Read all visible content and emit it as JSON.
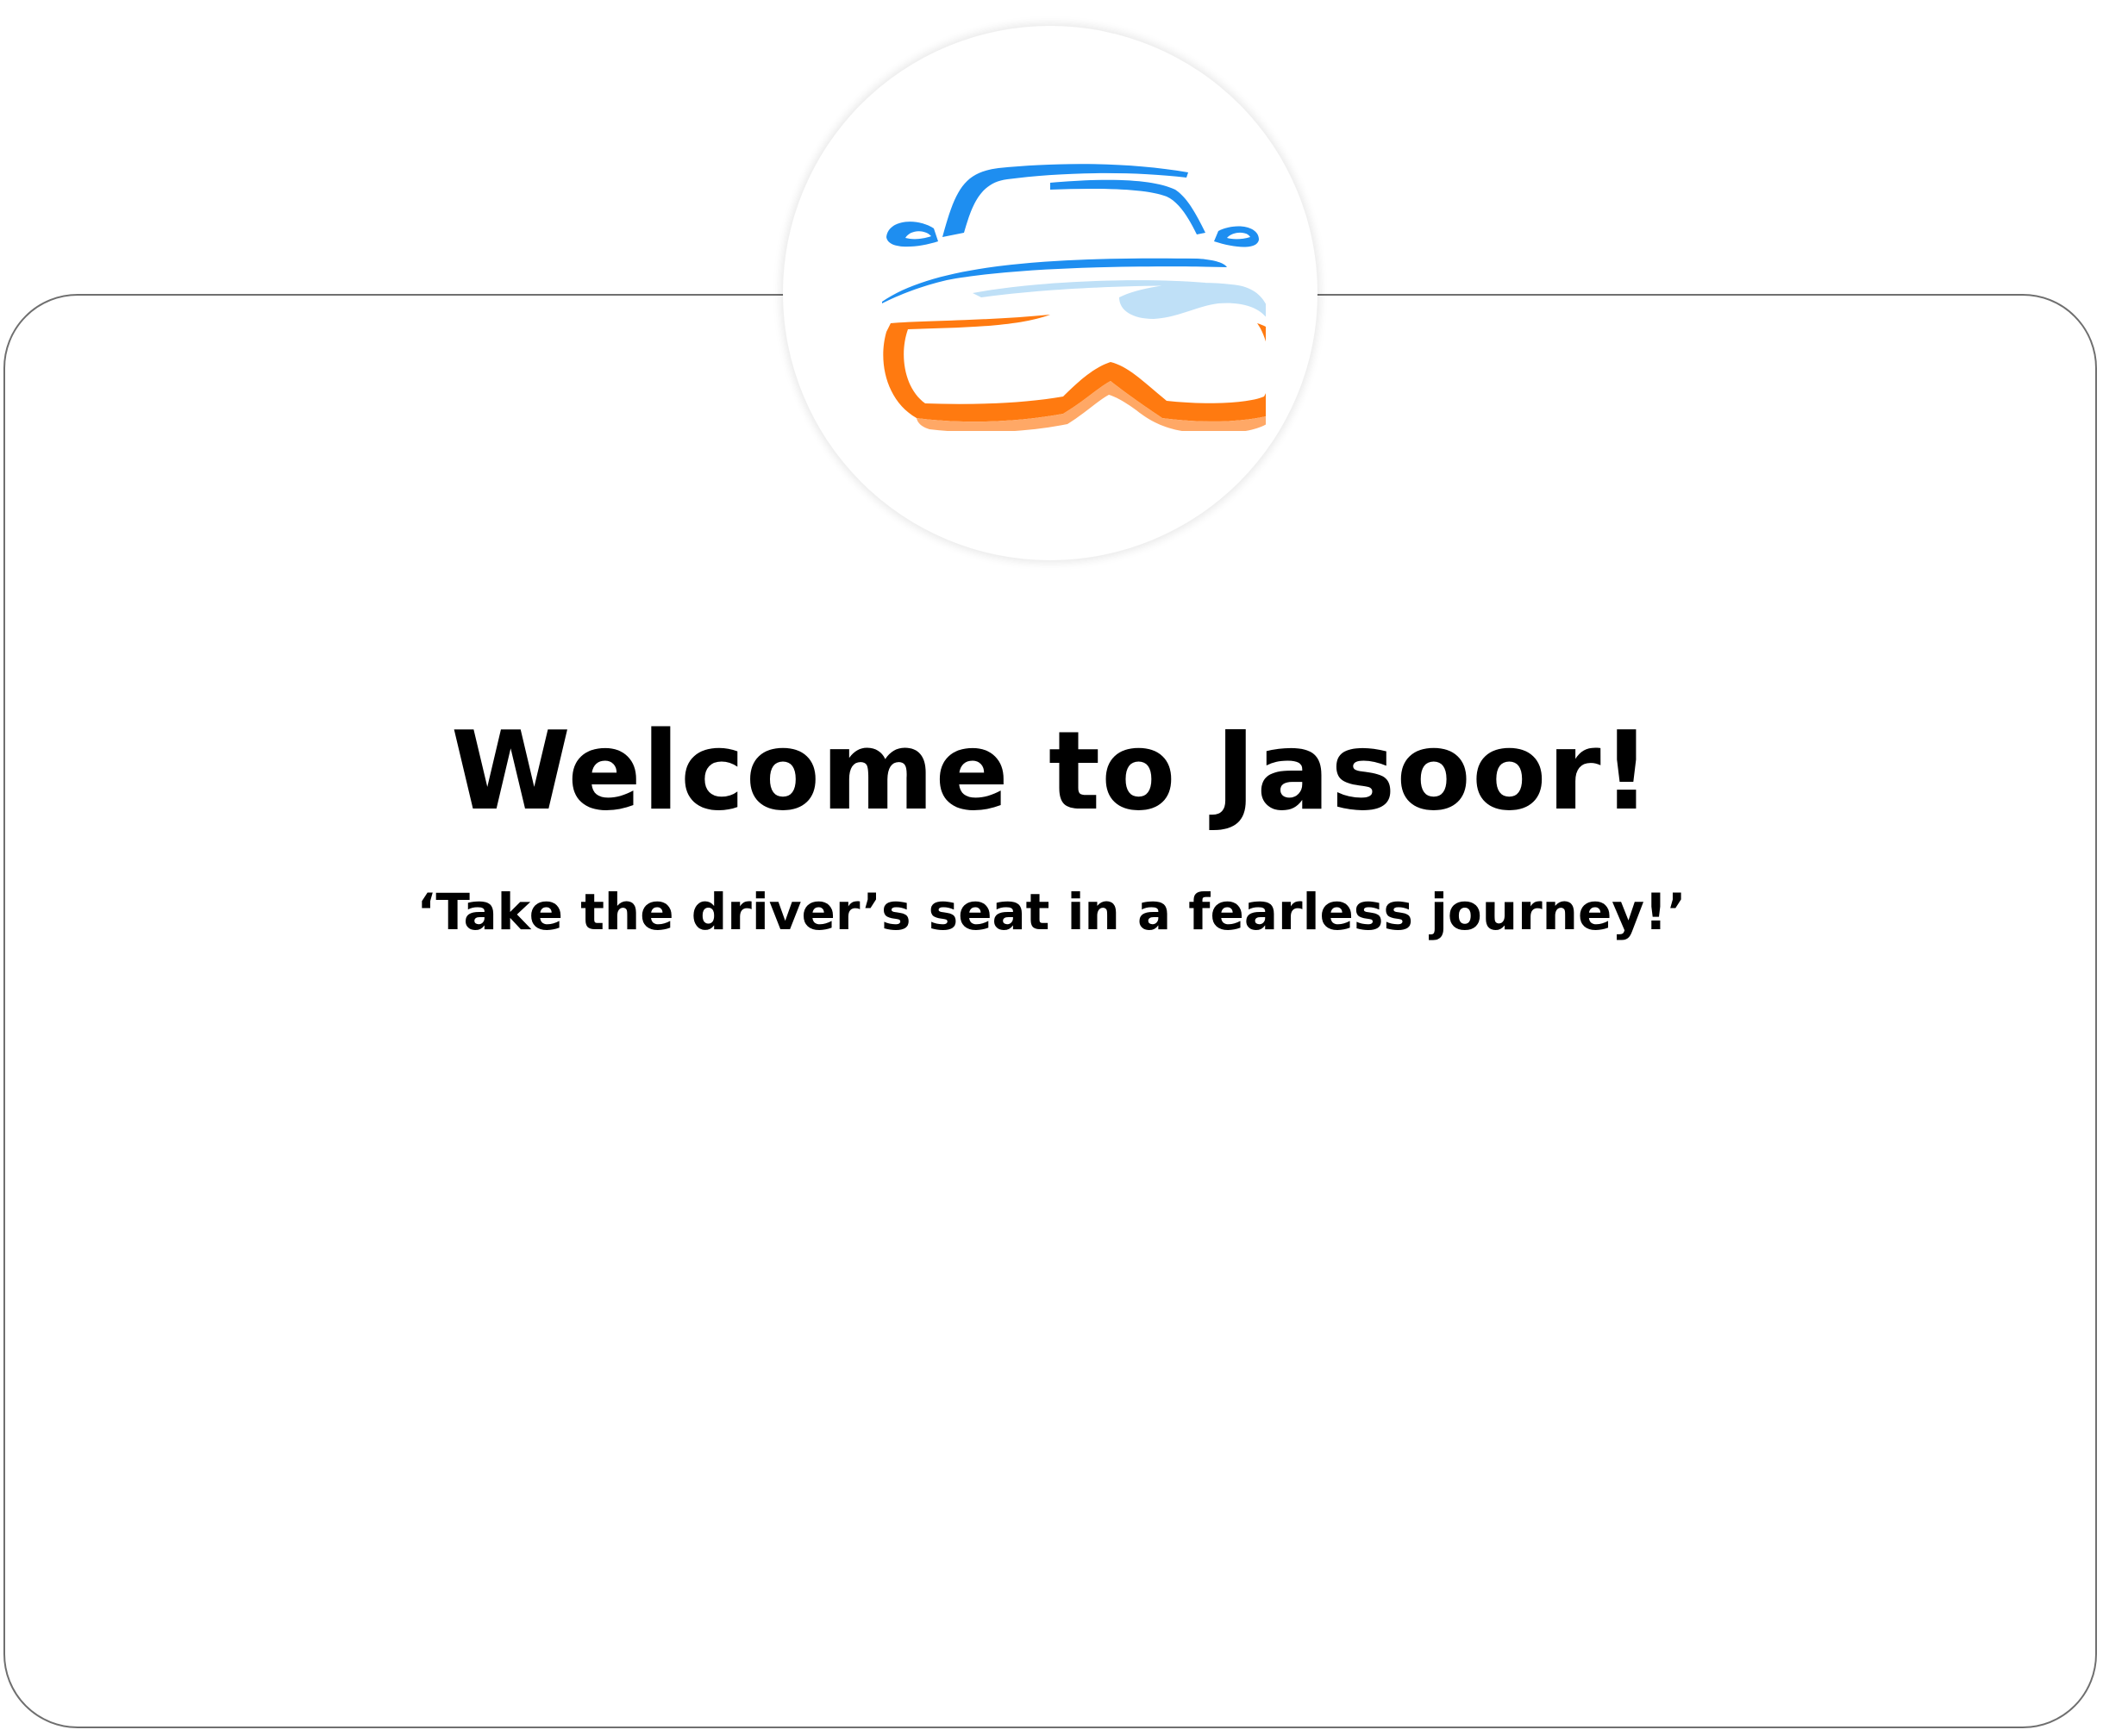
{
  "welcome": {
    "title": "Welcome to Jasoor!",
    "tagline": "‘Take the driver’s seat in a fearless journey!’"
  },
  "logo": {
    "icon": "car-logo-icon",
    "colors": {
      "blue": "#1e8ef0",
      "light_blue": "#bfe0f7",
      "orange": "#ff7a10",
      "light_orange": "#ffa866"
    }
  },
  "theme": {
    "background": "#ffffff",
    "card_border": "#6f6f6f",
    "text": "#000000"
  }
}
